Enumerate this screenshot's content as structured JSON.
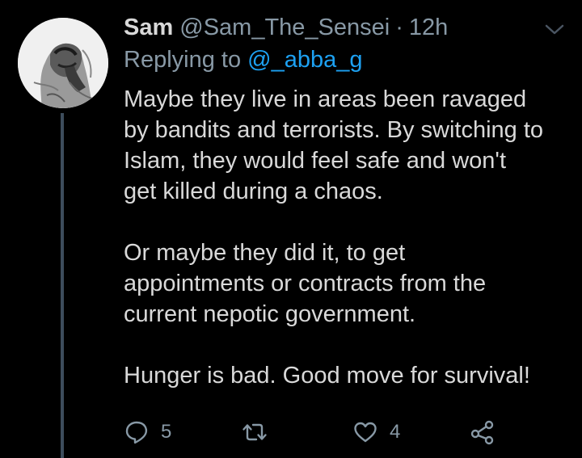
{
  "tweet": {
    "display_name": "Sam",
    "handle": "@Sam_The_Sensei",
    "separator": "·",
    "time": "12h",
    "replying_prefix": "Replying to",
    "replying_to": "@_abba_g",
    "body": [
      "Maybe they live in areas been ravaged",
      "by bandits and terrorists. By switching to",
      "Islam, they would feel safe  and won't",
      "get killed during a chaos.",
      "",
      "Or maybe they did it, to get",
      "appointments or contracts from the",
      "current  nepotic government.",
      "",
      "Hunger is bad. Good move for survival!"
    ],
    "actions": {
      "reply_count": "5",
      "retweet_count": "",
      "like_count": "4"
    }
  },
  "icons": {
    "reply": "reply-icon",
    "retweet": "retweet-icon",
    "like": "heart-icon",
    "share": "share-icon",
    "menu": "chevron-down-icon"
  },
  "colors": {
    "background": "#000000",
    "text": "#d9d9d9",
    "muted": "#8899a6",
    "link": "#1da1f2",
    "thread_line": "#3d4d5c"
  }
}
